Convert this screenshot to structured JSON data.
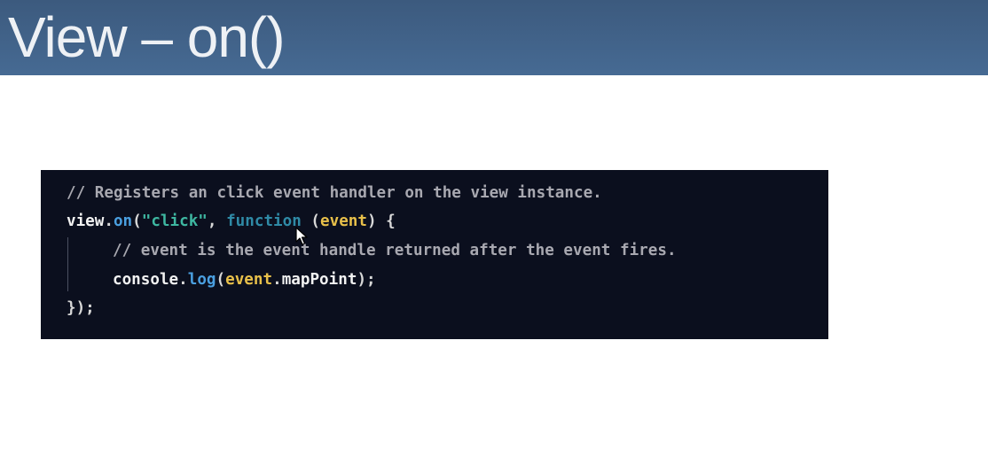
{
  "slide": {
    "title": "View – on()"
  },
  "code": {
    "line1_comment": "// Registers an click event handler on the view instance.",
    "line2": {
      "obj": "view",
      "dot": ".",
      "method": "on",
      "open_paren": "(",
      "string": "\"click\"",
      "comma": ", ",
      "keyword": "function",
      "space_paren": " (",
      "param": "event",
      "close": ") {"
    },
    "line3_comment": "// event is the event handle returned after the event fires.",
    "line4": {
      "obj": "console",
      "dot": ".",
      "method": "log",
      "open_paren": "(",
      "arg_obj": "event",
      "arg_dot": ".",
      "arg_prop": "mapPoint",
      "close": ");"
    },
    "line5": "});"
  },
  "colors": {
    "title_bar": "#466a93",
    "code_background": "#0b0f1e",
    "comment": "#a8a8b0",
    "method": "#4a9fe0",
    "string": "#3eb7a1",
    "keyword": "#2f8aa6",
    "param": "#e8c04a"
  },
  "icons": {
    "cursor": "mouse-pointer-icon"
  }
}
